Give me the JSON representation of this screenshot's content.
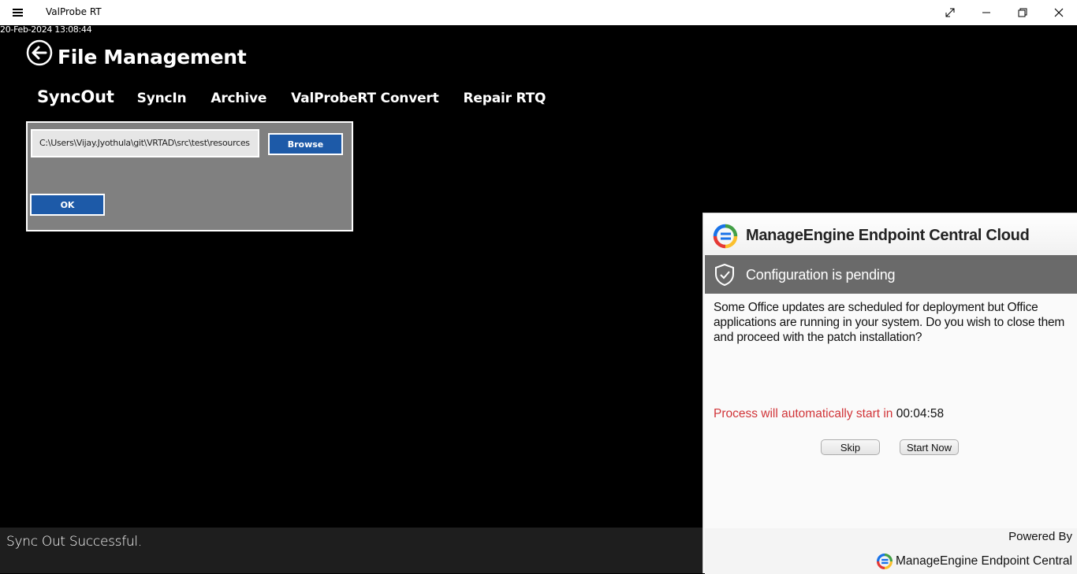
{
  "window": {
    "title": "ValProbe RT",
    "controls": [
      "expand-icon",
      "minimize-icon",
      "restore-icon",
      "close-icon"
    ]
  },
  "timestamp": "20-Feb-2024 13:08:44",
  "page": {
    "title": "File Management"
  },
  "tabs": [
    {
      "label": "SyncOut",
      "active": true
    },
    {
      "label": "SyncIn"
    },
    {
      "label": "Archive"
    },
    {
      "label": "ValProbeRT Convert"
    },
    {
      "label": "Repair RTQ"
    }
  ],
  "syncout_panel": {
    "path_value": "C:\\Users\\Vijay.Jyothula\\git\\VRTAD\\src\\test\\resources",
    "browse_label": "Browse",
    "ok_label": "OK"
  },
  "status": {
    "message": "Sync Out Successful."
  },
  "notification": {
    "app_name": "ManageEngine Endpoint Central Cloud",
    "banner": "Configuration is pending",
    "message": "Some Office updates are scheduled for deployment but Office applications are running in your system. Do you wish to close them and proceed with the patch installation?",
    "countdown_label": "Process will automatically start in",
    "countdown_value": "00:04:58",
    "skip_label": "Skip",
    "start_label": "Start Now",
    "powered_by": "Powered By",
    "brand": "ManageEngine Endpoint Central",
    "colors": {
      "countdown": "#d13438",
      "banner_bg": "#6a6a6a",
      "accent_blue": "#1d5aa8"
    }
  }
}
